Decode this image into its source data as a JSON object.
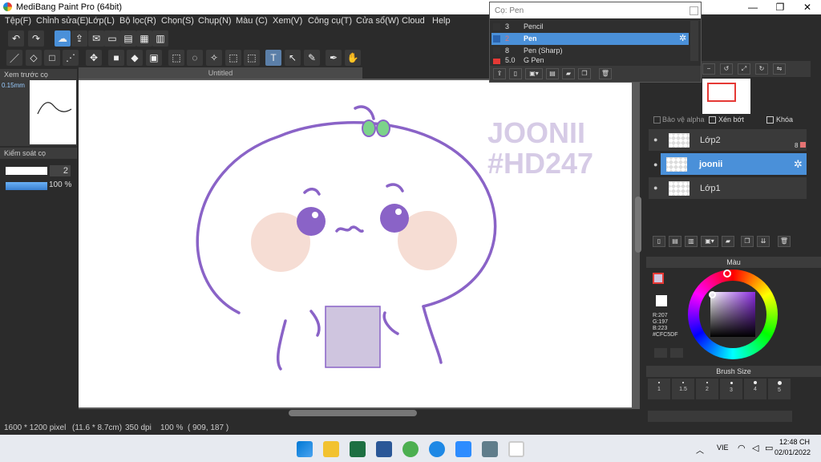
{
  "window": {
    "title": "MediBang Paint Pro (64bit)",
    "min": "—",
    "max": "❐",
    "close": "✕"
  },
  "menu": [
    "Tệp(F)",
    "Chỉnh sửa(E)",
    "Lớp(L)",
    "Bộ lọc(R)",
    "Chọn(S)",
    "Chụp(N)",
    "Màu (C)",
    "Xem(V)",
    "Công cụ(T)",
    "Cửa sổ(W)",
    "Cloud",
    "Help"
  ],
  "left": {
    "preview_title": "Xem trước cọ",
    "preview_size": "0.15mm",
    "control_title": "Kiểm soát cọ",
    "brush_width_value": "2",
    "opacity_value": "100 %"
  },
  "document": {
    "tab_title": "Untitled"
  },
  "artwork": {
    "watermark_line1": "JOONII",
    "watermark_line2": "#HD247",
    "stroke_color": "#8a63c7",
    "cheek_color": "#f6ddd4",
    "paper_color": "#cfc5df"
  },
  "brush_window": {
    "title": "Cọ: Pen",
    "items": [
      {
        "size": "3",
        "name": "Pencil",
        "color": "#333333"
      },
      {
        "size": "2",
        "name": "Pen",
        "color": "#2a64b0"
      },
      {
        "size": "8",
        "name": "Pen (Sharp)",
        "color": "#333333"
      },
      {
        "size": "5.0",
        "name": "G Pen",
        "color": "#e53935"
      }
    ]
  },
  "layers": {
    "protect_alpha": "Bảo vệ alpha",
    "clipping": "Xén bớt",
    "lock": "Khóa",
    "items": [
      {
        "name": "Lớp2",
        "badge": "8"
      },
      {
        "name": "joonii",
        "badge": ""
      },
      {
        "name": "Lớp1",
        "badge": ""
      }
    ]
  },
  "color_panel": {
    "title": "Màu",
    "r": "R:207",
    "g": "G:197",
    "b": "B:223",
    "hex": "#CFC5DF",
    "current_color": "#cfc5df"
  },
  "brush_size_panel": {
    "title": "Brush Size",
    "sizes": [
      "1",
      "1.5",
      "2",
      "3",
      "4",
      "5"
    ]
  },
  "status": {
    "dimensions": "1600 * 1200 pixel",
    "cm": "(11.6 * 8.7cm)",
    "dpi": "350 dpi",
    "zoom": "100 %",
    "coords": "( 909, 187 )"
  },
  "taskbar": {
    "lang": "VIE",
    "time": "12:48 CH",
    "date": "02/01/2022",
    "caret": "︿"
  },
  "colors": {
    "accent": "#4a90d9",
    "bg": "#2b2b2b"
  }
}
